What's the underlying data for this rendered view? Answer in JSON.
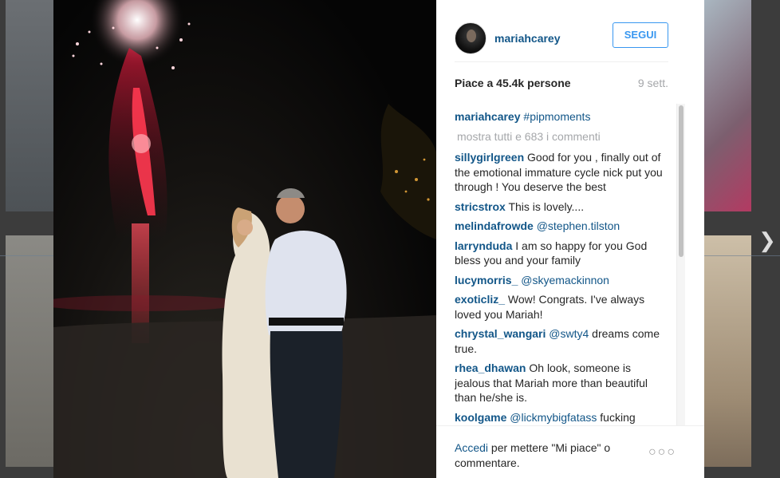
{
  "post": {
    "username": "mariahcarey",
    "follow_label": "SEGUI",
    "likes_label": "Piace a 45.4k persone",
    "age": "9 sett.",
    "caption": {
      "username": "mariahcarey",
      "text": "#pipmoments"
    },
    "show_all_comments": "mostra tutti e 683 i commenti"
  },
  "comments": [
    {
      "username": "sillygirlgreen",
      "text": "Good for you , finally out of the emotional immature cycle nick put you through ! You deserve the best",
      "mention": ""
    },
    {
      "username": "stricstrox",
      "text": "This is lovely....",
      "mention": ""
    },
    {
      "username": "melindafrowde",
      "text": "",
      "mention": "@stephen.tilston"
    },
    {
      "username": "larrynduda",
      "text": "I am so happy for you God bless you and your family",
      "mention": ""
    },
    {
      "username": "lucymorris_",
      "text": "",
      "mention": "@skyemackinnon"
    },
    {
      "username": "exoticliz_",
      "text": "Wow! Congrats. I've always loved you Mariah!",
      "mention": ""
    },
    {
      "username": "chrystal_wangari",
      "mention": "@swty4",
      "text": "dreams come true."
    },
    {
      "username": "rhea_dhawan",
      "text": "Oh look, someone is jealous that Mariah more than beautiful than he/she is.",
      "mention": ""
    },
    {
      "username": "koolgame",
      "mention": "@lickmybigfatass",
      "text": "fucking"
    }
  ],
  "footer": {
    "login_link": "Accedi",
    "login_text": "per mettere \"Mi piace\" o commentare.",
    "more_icon": "ellipsis-icon"
  },
  "navigation": {
    "next_icon": "chevron-right-icon"
  },
  "colors": {
    "link": "#125688",
    "follow": "#3897f0",
    "muted": "#a5a7aa"
  }
}
